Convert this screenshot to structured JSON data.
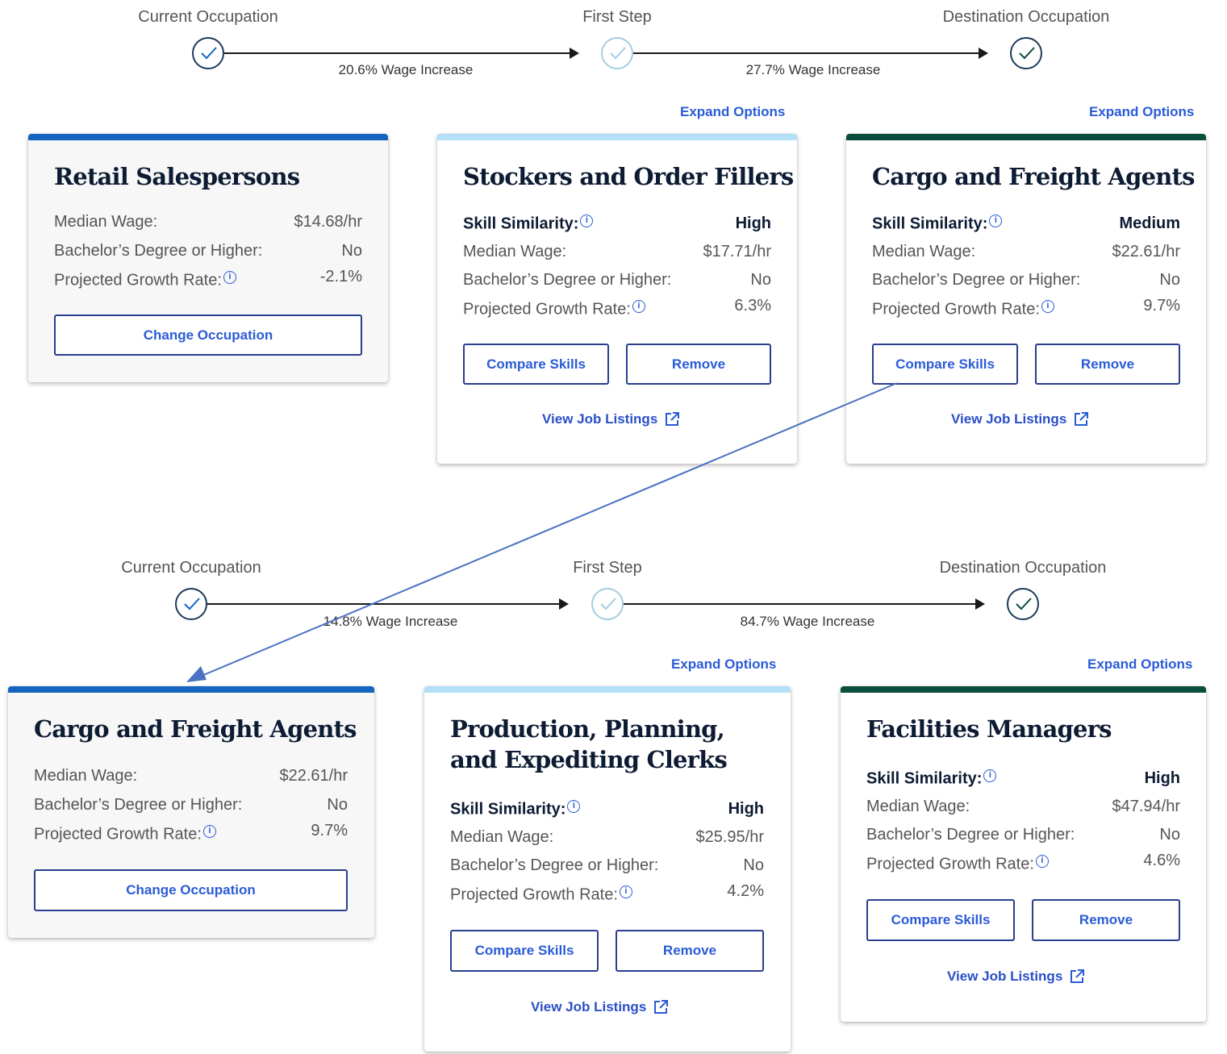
{
  "paths": [
    {
      "step_labels": [
        "Current Occupation",
        "First Step",
        "Destination Occupation"
      ],
      "wage_labels": [
        "20.6% Wage Increase",
        "27.7% Wage Increase"
      ],
      "expand_label": "Expand Options",
      "cards": [
        {
          "title": "Retail Salespersons",
          "rows": [
            {
              "label": "Median Wage:",
              "value": "$14.68/hr"
            },
            {
              "label": "Bachelor’s Degree or Higher:",
              "value": "No"
            },
            {
              "label": "Projected Growth Rate:",
              "value": "-2.1%"
            }
          ],
          "button": "Change Occupation"
        },
        {
          "title": "Stockers and Order Fillers",
          "skill": {
            "label": "Skill Similarity:",
            "value": "High"
          },
          "rows": [
            {
              "label": "Median Wage:",
              "value": "$17.71/hr"
            },
            {
              "label": "Bachelor’s Degree or Higher:",
              "value": "No"
            },
            {
              "label": "Projected Growth Rate:",
              "value": "6.3%"
            }
          ],
          "compare": "Compare Skills",
          "remove": "Remove",
          "jobs": "View Job Listings"
        },
        {
          "title": "Cargo and Freight Agents",
          "skill": {
            "label": "Skill Similarity:",
            "value": "Medium"
          },
          "rows": [
            {
              "label": "Median Wage:",
              "value": "$22.61/hr"
            },
            {
              "label": "Bachelor’s Degree or Higher:",
              "value": "No"
            },
            {
              "label": "Projected Growth Rate:",
              "value": "9.7%"
            }
          ],
          "compare": "Compare Skills",
          "remove": "Remove",
          "jobs": "View Job Listings"
        }
      ]
    },
    {
      "step_labels": [
        "Current Occupation",
        "First Step",
        "Destination Occupation"
      ],
      "wage_labels": [
        "14.8% Wage Increase",
        "84.7% Wage Increase"
      ],
      "expand_label": "Expand Options",
      "cards": [
        {
          "title": "Cargo and Freight Agents",
          "rows": [
            {
              "label": "Median Wage:",
              "value": "$22.61/hr"
            },
            {
              "label": "Bachelor’s Degree or Higher:",
              "value": "No"
            },
            {
              "label": "Projected Growth Rate:",
              "value": "9.7%"
            }
          ],
          "button": "Change Occupation"
        },
        {
          "title": "Production, Planning, and Expediting Clerks",
          "skill": {
            "label": "Skill Similarity:",
            "value": "High"
          },
          "rows": [
            {
              "label": "Median Wage:",
              "value": "$25.95/hr"
            },
            {
              "label": "Bachelor’s Degree or Higher:",
              "value": "No"
            },
            {
              "label": "Projected Growth Rate:",
              "value": "4.2%"
            }
          ],
          "compare": "Compare Skills",
          "remove": "Remove",
          "jobs": "View Job Listings"
        },
        {
          "title": "Facilities Managers",
          "skill": {
            "label": "Skill Similarity:",
            "value": "High"
          },
          "rows": [
            {
              "label": "Median Wage:",
              "value": "$47.94/hr"
            },
            {
              "label": "Bachelor’s Degree or Higher:",
              "value": "No"
            },
            {
              "label": "Projected Growth Rate:",
              "value": "4.6%"
            }
          ],
          "compare": "Compare Skills",
          "remove": "Remove",
          "jobs": "View Job Listings"
        }
      ]
    }
  ],
  "icons": {
    "check": "check-icon",
    "info": "info-icon",
    "external": "external-link-icon"
  },
  "colors": {
    "current_bar": "#1565c0",
    "first_step_bar": "#b3e0f7",
    "destination_bar": "#0b4d3c",
    "link_blue": "#2a5bd7",
    "annotation_arrow": "#4a72c2"
  }
}
